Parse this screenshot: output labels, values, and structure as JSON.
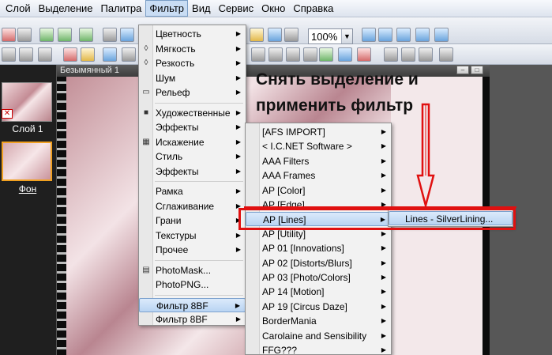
{
  "menubar": {
    "items": [
      "Слой",
      "Выделение",
      "Палитра",
      "Фильтр",
      "Вид",
      "Сервис",
      "Окно",
      "Справка"
    ],
    "active_index": 3
  },
  "toolbar": {
    "zoom_value": "100%"
  },
  "document": {
    "title": "Безымянный 1"
  },
  "layers": {
    "layer1": "Слой 1",
    "background": "Фон"
  },
  "annotation": {
    "line1": "Снять выделение и",
    "line2": "применить фильтр"
  },
  "filter_menu": {
    "items": [
      {
        "label": "Цветность",
        "icon": "",
        "submenu": true
      },
      {
        "label": "Мягкость",
        "icon": "drop-icon",
        "submenu": true
      },
      {
        "label": "Резкость",
        "icon": "sharpen-drop-icon",
        "submenu": true
      },
      {
        "label": "Шум",
        "icon": "",
        "submenu": true
      },
      {
        "label": "Рельеф",
        "icon": "emboss-icon",
        "submenu": true
      },
      {
        "separator": true
      },
      {
        "label": "Художественные",
        "icon": "artistic-icon",
        "submenu": true
      },
      {
        "label": "Эффекты",
        "icon": "",
        "submenu": true
      },
      {
        "label": "Искажение",
        "icon": "distort-icon",
        "submenu": true
      },
      {
        "label": "Стиль",
        "icon": "",
        "submenu": true
      },
      {
        "label": "Эффекты",
        "icon": "",
        "submenu": true
      },
      {
        "separator": true
      },
      {
        "label": "Рамка",
        "icon": "",
        "submenu": true
      },
      {
        "label": "Сглаживание",
        "icon": "",
        "submenu": true
      },
      {
        "label": "Грани",
        "icon": "",
        "submenu": true
      },
      {
        "label": "Текстуры",
        "icon": "",
        "submenu": true
      },
      {
        "label": "Прочее",
        "icon": "",
        "submenu": true
      },
      {
        "separator": true
      },
      {
        "label": "PhotoMask...",
        "icon": "photomask-icon",
        "submenu": false
      },
      {
        "label": "PhotoPNG...",
        "icon": "",
        "submenu": false
      },
      {
        "separator": true
      },
      {
        "label": "Фильтр 8BF",
        "icon": "",
        "submenu": true,
        "highlighted": true
      },
      {
        "label": "Фильтр 8BF",
        "icon": "",
        "submenu": true
      }
    ]
  },
  "plugins_menu": {
    "items": [
      "[AFS IMPORT]",
      "< I.C.NET Software >",
      "AAA Filters",
      "AAA Frames",
      "AP [Color]",
      "AP [Edge]",
      "AP [Lines]",
      "AP [Utility]",
      "AP 01 [Innovations]",
      "AP 02 [Distorts/Blurs]",
      "AP 03 [Photo/Colors]",
      "AP 14 [Motion]",
      "AP 19 [Circus Daze]",
      "BorderMania",
      "Carolaine and Sensibility",
      "FFG???"
    ],
    "highlighted_index": 6
  },
  "lines_menu": {
    "items": [
      "Lines - SilverLining..."
    ]
  },
  "colors": {
    "highlight_border": "#e01010",
    "menu_highlight": "#b9d4f2",
    "active_layer_border": "#f0a020"
  }
}
